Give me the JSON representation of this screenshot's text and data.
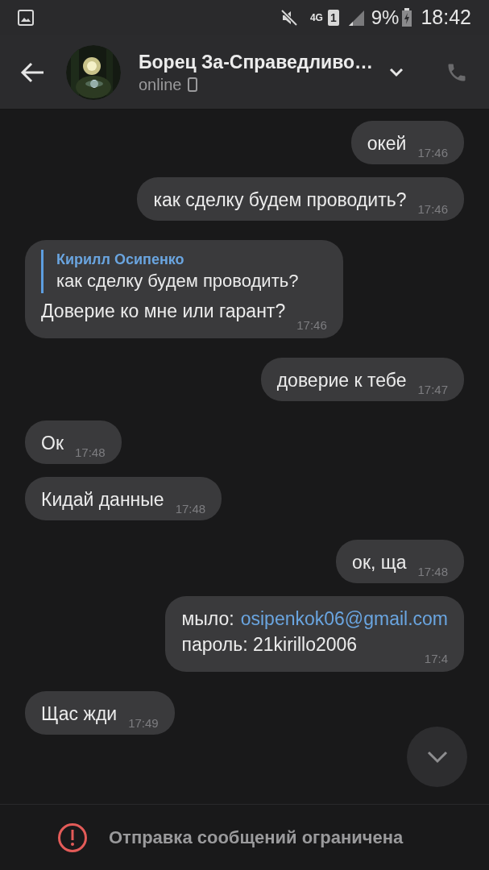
{
  "status_bar": {
    "network_type": "4G",
    "sim": "1",
    "battery": "9%",
    "time": "18:42"
  },
  "header": {
    "name": "Борец За-Справедливо…",
    "status": "online"
  },
  "messages": [
    {
      "outgoing": true,
      "lines": [
        {
          "text": "окей"
        }
      ],
      "time": "17:46"
    },
    {
      "outgoing": true,
      "lines": [
        {
          "text": "как сделку будем проводить?"
        }
      ],
      "time": "17:46"
    },
    {
      "outgoing": false,
      "reply": {
        "author": "Кирилл Осипенко",
        "text": "как сделку будем проводить?"
      },
      "lines": [
        {
          "text": "Доверие ко мне или гарант?"
        }
      ],
      "time": "17:46"
    },
    {
      "outgoing": true,
      "lines": [
        {
          "text": "доверие к тебе"
        }
      ],
      "time": "17:47"
    },
    {
      "outgoing": false,
      "lines": [
        {
          "text": "Ок"
        }
      ],
      "time": "17:48"
    },
    {
      "outgoing": false,
      "lines": [
        {
          "text": "Кидай данные"
        }
      ],
      "time": "17:48"
    },
    {
      "outgoing": true,
      "lines": [
        {
          "text": "ок, ща"
        }
      ],
      "time": "17:48"
    },
    {
      "outgoing": true,
      "lines": [
        {
          "text": "мыло:",
          "link": "osipenkok06@gmail.com"
        },
        {
          "text": "пароль: 21kirillo2006"
        }
      ],
      "time": "17:4"
    },
    {
      "outgoing": false,
      "lines": [
        {
          "text": "Щас жди"
        }
      ],
      "time": "17:49"
    }
  ],
  "footer": {
    "notice": "Отправка сообщений ограничена"
  }
}
